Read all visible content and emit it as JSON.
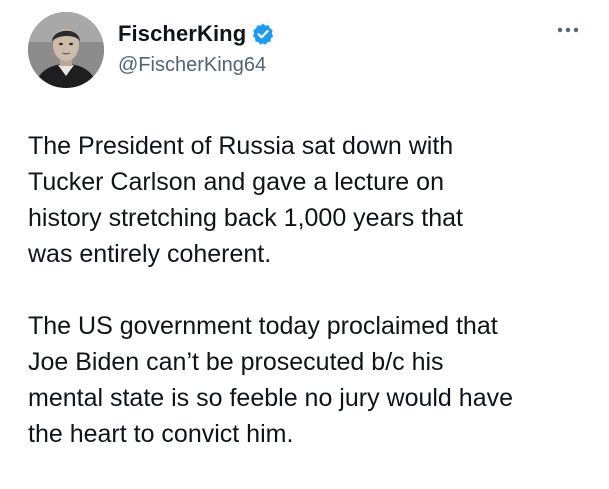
{
  "author": {
    "display_name": "FischerKing",
    "handle": "@FischerKing64",
    "verified": true
  },
  "icons": {
    "avatar": "avatar-photo",
    "verified": "verified-badge-icon",
    "more": "more-options-icon"
  },
  "colors": {
    "text": "#0f1419",
    "secondary_text": "#536471",
    "verified_blue": "#1d9bf0",
    "background": "#ffffff"
  },
  "post": {
    "paragraphs": [
      "The President of Russia sat down with\nTucker Carlson and gave a lecture on\nhistory stretching back 1,000 years that\nwas entirely coherent.",
      "The US government today proclaimed that\nJoe Biden can’t be prosecuted b/c his\nmental state is so feeble no jury would have\nthe heart to convict him."
    ]
  }
}
